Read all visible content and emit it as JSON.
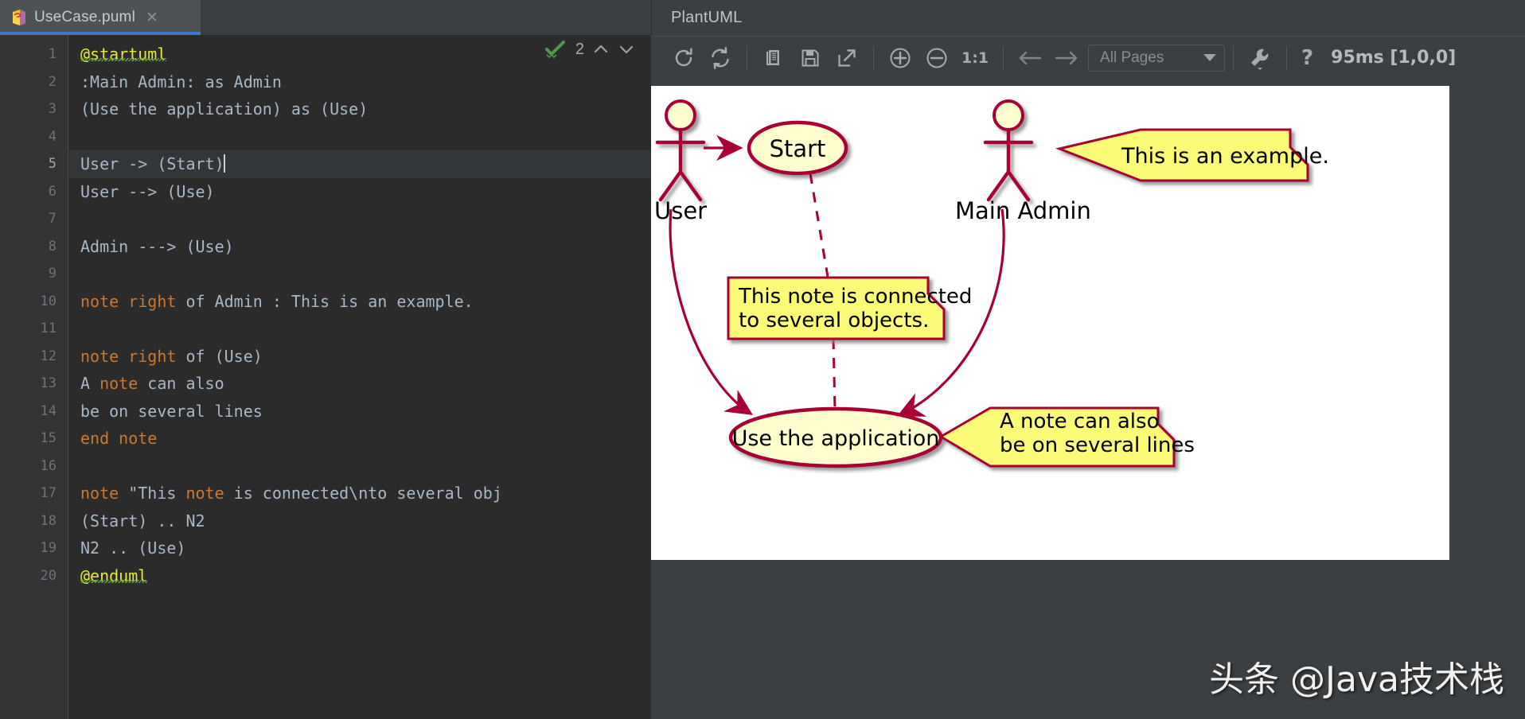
{
  "editor": {
    "tab": {
      "filename": "UseCase.puml",
      "close_label": "✕",
      "icon": "plantuml-file-icon"
    },
    "inspection": {
      "count": "2",
      "status_icon": "green-check-icon",
      "up_icon": "chevron-up-icon",
      "down_icon": "chevron-down-icon"
    },
    "lines": [
      {
        "n": "1",
        "segments": [
          {
            "t": "@startuml",
            "c": "anno"
          }
        ]
      },
      {
        "n": "2",
        "segments": [
          {
            "t": ":Main Admin: as Admin",
            "c": ""
          }
        ]
      },
      {
        "n": "3",
        "segments": [
          {
            "t": "(Use the application) as (Use)",
            "c": ""
          }
        ]
      },
      {
        "n": "4",
        "segments": [
          {
            "t": "",
            "c": ""
          }
        ]
      },
      {
        "n": "5",
        "segments": [
          {
            "t": "User -> (Start)",
            "c": ""
          },
          {
            "t": "",
            "c": "caret"
          }
        ],
        "highlight": true
      },
      {
        "n": "6",
        "segments": [
          {
            "t": "User --> (Use)",
            "c": ""
          }
        ]
      },
      {
        "n": "7",
        "segments": [
          {
            "t": "",
            "c": ""
          }
        ]
      },
      {
        "n": "8",
        "segments": [
          {
            "t": "Admin ---> (Use)",
            "c": ""
          }
        ]
      },
      {
        "n": "9",
        "segments": [
          {
            "t": "",
            "c": ""
          }
        ]
      },
      {
        "n": "10",
        "segments": [
          {
            "t": "note right",
            "c": "kw"
          },
          {
            "t": " of Admin : This is an example.",
            "c": ""
          }
        ]
      },
      {
        "n": "11",
        "segments": [
          {
            "t": "",
            "c": ""
          }
        ]
      },
      {
        "n": "12",
        "segments": [
          {
            "t": "note right",
            "c": "kw"
          },
          {
            "t": " of (Use)",
            "c": ""
          }
        ]
      },
      {
        "n": "13",
        "segments": [
          {
            "t": "A ",
            "c": ""
          },
          {
            "t": "note",
            "c": "kw"
          },
          {
            "t": " can also",
            "c": ""
          }
        ]
      },
      {
        "n": "14",
        "segments": [
          {
            "t": "be on several lines",
            "c": ""
          }
        ]
      },
      {
        "n": "15",
        "segments": [
          {
            "t": "end note",
            "c": "kw"
          }
        ]
      },
      {
        "n": "16",
        "segments": [
          {
            "t": "",
            "c": ""
          }
        ]
      },
      {
        "n": "17",
        "segments": [
          {
            "t": "note",
            "c": "kw"
          },
          {
            "t": " \"This ",
            "c": ""
          },
          {
            "t": "note",
            "c": "kw"
          },
          {
            "t": " is connected\\nto several obj",
            "c": ""
          }
        ]
      },
      {
        "n": "18",
        "segments": [
          {
            "t": "(Start) .. N2",
            "c": ""
          }
        ]
      },
      {
        "n": "19",
        "segments": [
          {
            "t": "N2 .. (Use)",
            "c": ""
          }
        ]
      },
      {
        "n": "20",
        "segments": [
          {
            "t": "@enduml",
            "c": "anno"
          }
        ]
      }
    ]
  },
  "preview": {
    "title": "PlantUML",
    "toolbar": {
      "reload_icon": "reload-icon",
      "refresh_icon": "refresh-icon",
      "copy_icon": "copy-icon",
      "save_icon": "save-icon",
      "export_icon": "export-external-icon",
      "zoom_in_icon": "zoom-in-icon",
      "zoom_out_icon": "zoom-out-icon",
      "actual_size_label": "1:1",
      "prev_page_icon": "arrow-left-icon",
      "next_page_icon": "arrow-right-icon",
      "pages_selected": "All Pages",
      "settings_icon": "wrench-icon",
      "help_label": "?",
      "timing": "95ms [1,0,0]"
    }
  },
  "diagram": {
    "actors": [
      {
        "name": "User"
      },
      {
        "name": "Main Admin"
      }
    ],
    "usecases": [
      {
        "name": "Start"
      },
      {
        "name": "Use the application"
      }
    ],
    "notes": [
      {
        "lines": [
          "This is an example."
        ]
      },
      {
        "lines": [
          "This note is connected",
          "to several objects."
        ]
      },
      {
        "lines": [
          "A note can also",
          "be on several lines"
        ]
      }
    ],
    "colors": {
      "stroke": "#A80036",
      "fill": "#FEFECE",
      "note_fill": "#FBFB77",
      "note_stroke": "#A80036",
      "text": "#000000"
    }
  },
  "watermark": {
    "text": "头条 @Java技术栈"
  }
}
